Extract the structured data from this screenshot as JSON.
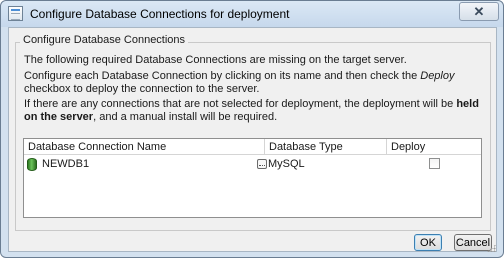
{
  "window": {
    "title": "Configure Database Connections for deployment",
    "close_symbol": "✕"
  },
  "group": {
    "title": "Configure Database Connections"
  },
  "messages": {
    "line1": "The following required Database Connections are missing on the target server.",
    "line2_before": "Configure each Database Connection by clicking on its name and then check the ",
    "line2_italic": "Deploy",
    "line2_after": " checkbox to deploy the connection to the server.",
    "line3_before": "If there are any connections that are not selected for deployment, the deployment will be ",
    "line3_bold": "held on the server",
    "line3_after": ", and a manual install will be required."
  },
  "table": {
    "columns": [
      "Database Connection Name",
      "Database Type",
      "Deploy"
    ],
    "rows": [
      {
        "name": "NEWDB1",
        "type": "MySQL",
        "deploy": false
      }
    ]
  },
  "buttons": {
    "ok": "OK",
    "cancel": "Cancel"
  },
  "icons": {
    "app": "window-app-icon",
    "db": "database-cylinder-icon",
    "type": "database-type-icon",
    "close": "close-icon"
  },
  "colors": {
    "frame": "#d3e1ef",
    "client": "#f0f0f0",
    "db_icon": "#3e9a2e",
    "ok_border": "#3c7fb1"
  }
}
